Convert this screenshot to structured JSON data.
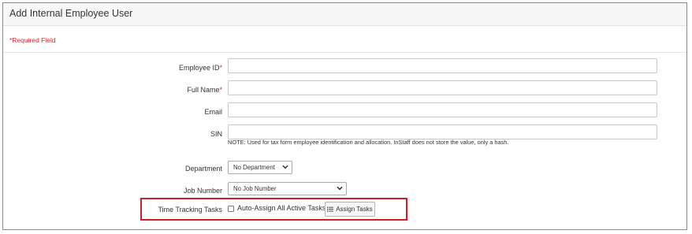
{
  "panel": {
    "title": "Add Internal Employee User",
    "required_note": "*Required Field"
  },
  "form": {
    "employee_id": {
      "label": "Employee ID",
      "required_mark": "*",
      "value": ""
    },
    "full_name": {
      "label": "Full Name",
      "required_mark": "*",
      "value": ""
    },
    "email": {
      "label": "Email",
      "value": ""
    },
    "sin": {
      "label": "SIN",
      "value": "",
      "note": "NOTE: Used for tax form employee identification and allocation. InStaff does not store the value, only a hash."
    },
    "department": {
      "label": "Department",
      "selected": "No Department"
    },
    "job_number": {
      "label": "Job Number",
      "selected": "No Job Number"
    },
    "time_tracking": {
      "label": "Time Tracking Tasks",
      "auto_assign_label": "Auto-Assign All Active Tasks",
      "auto_assign_checked": false,
      "assign_button_label": "Assign Tasks"
    }
  },
  "icons": {
    "dropdown": "chevron-down-icon",
    "assign": "list-icon"
  },
  "colors": {
    "required": "#e0222b",
    "highlight": "#d11f27"
  }
}
